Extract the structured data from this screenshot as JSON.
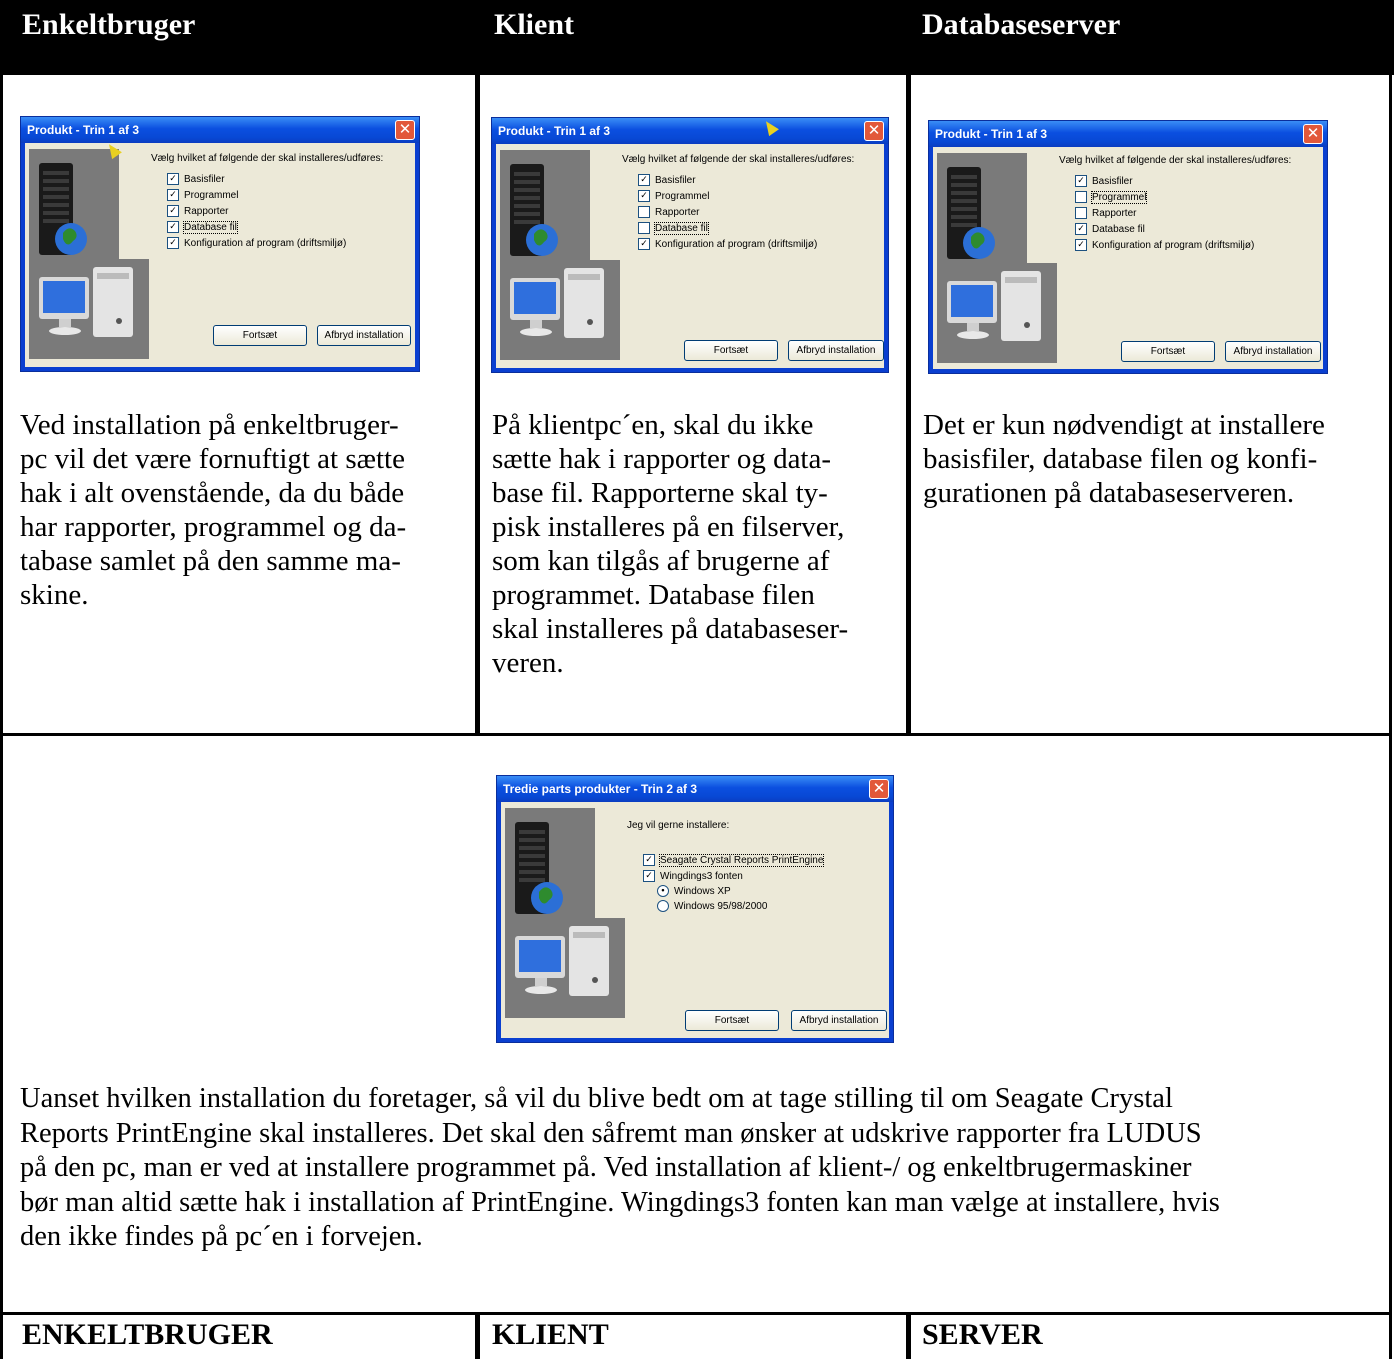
{
  "headers": [
    "Enkeltbruger",
    "Klient",
    "Databaseserver"
  ],
  "dialogs": [
    {
      "title": "Produkt - Trin 1 af 3",
      "prompt": "Vælg hvilket af følgende der skal installeres/udføres:",
      "options": [
        {
          "label": "Basisfiler",
          "checked": true
        },
        {
          "label": "Programmel",
          "checked": true
        },
        {
          "label": "Rapporter",
          "checked": true
        },
        {
          "label": "Database fil",
          "checked": true
        },
        {
          "label": "Konfiguration af program (driftsmiljø)",
          "checked": true
        }
      ],
      "continue": "Fortsæt",
      "cancel": "Afbryd installation",
      "close": "✕"
    },
    {
      "title": "Produkt - Trin 1 af 3",
      "prompt": "Vælg hvilket af følgende der skal installeres/udføres:",
      "options": [
        {
          "label": "Basisfiler",
          "checked": true
        },
        {
          "label": "Programmel",
          "checked": true
        },
        {
          "label": "Rapporter",
          "checked": false
        },
        {
          "label": "Database fil",
          "checked": false
        },
        {
          "label": "Konfiguration af program (driftsmiljø)",
          "checked": true
        }
      ],
      "continue": "Fortsæt",
      "cancel": "Afbryd installation",
      "close": "✕"
    },
    {
      "title": "Produkt - Trin 1 af 3",
      "prompt": "Vælg hvilket af følgende der skal installeres/udføres:",
      "options": [
        {
          "label": "Basisfiler",
          "checked": true
        },
        {
          "label": "Programmel",
          "checked": false
        },
        {
          "label": "Rapporter",
          "checked": false
        },
        {
          "label": "Database fil",
          "checked": true
        },
        {
          "label": "Konfiguration af program (driftsmiljø)",
          "checked": true
        }
      ],
      "continue": "Fortsæt",
      "cancel": "Afbryd installation",
      "close": "✕"
    }
  ],
  "columns_text": [
    "Ved installation på enkeltbruger-\npc vil det være fornuftigt at sætte\nhak i alt ovenstående, da du både\nhar rapporter, programmel og da-\ntabase samlet på den samme ma-\nskine.",
    "På klientpc´en, skal du ikke\nsætte hak i rapporter og data-\nbase fil. Rapporterne skal ty-\npisk installeres på en filserver,\nsom kan tilgås af brugerne af\nprogrammet. Database filen\nskal installeres på databaseser-\nveren.",
    "Det er kun nødvendigt at installere\nbasisfiler, database filen og konfi-\ngurationen på databaseserveren."
  ],
  "dialog2": {
    "title": "Tredie parts produkter - Trin 2 af 3",
    "prompt": "Jeg vil gerne installere:",
    "options": [
      {
        "label": "Seagate Crystal Reports PrintEngine",
        "checked": true
      },
      {
        "label": "Wingdings3 fonten",
        "checked": true
      }
    ],
    "radios": [
      {
        "label": "Windows XP",
        "selected": true
      },
      {
        "label": "Windows 95/98/2000",
        "selected": false
      }
    ],
    "continue": "Fortsæt",
    "cancel": "Afbryd installation",
    "close": "✕"
  },
  "bottom_text": "Uanset hvilken installation du foretager, så vil du blive bedt om at tage stilling til om Seagate Crystal\nReports PrintEngine skal installeres. Det skal den såfremt man ønsker at udskrive rapporter fra LUDUS\npå den pc, man er ved at installere programmet på. Ved installation af klient-/ og enkeltbrugermaskiner\nbør man altid sætte hak i installation af PrintEngine. Wingdings3 fonten kan man vælge at installere, hvis\nden ikke findes på pc´en i forvejen.",
  "footer_headers": [
    "ENKELTBRUGER",
    "KLIENT",
    "SERVER"
  ]
}
